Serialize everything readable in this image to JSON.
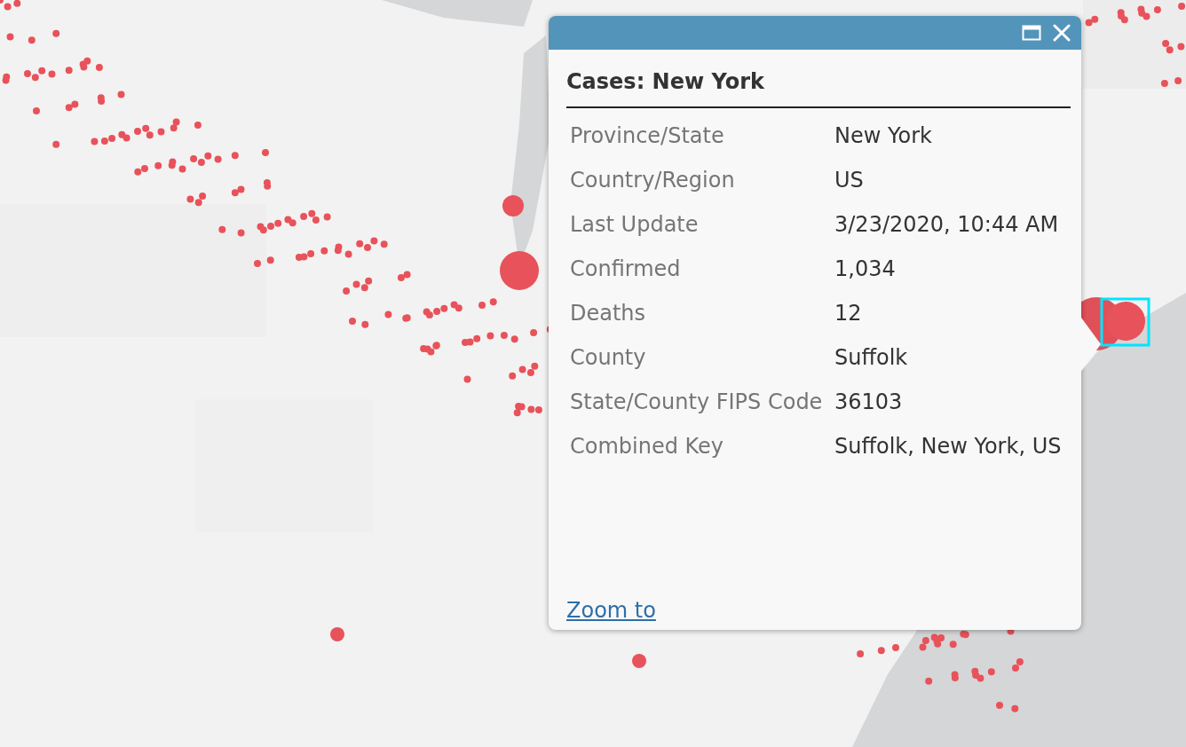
{
  "popup": {
    "title": "Cases: New York",
    "fields": [
      {
        "label": "Province/State",
        "value": "New York"
      },
      {
        "label": "Country/Region",
        "value": "US"
      },
      {
        "label": "Last Update",
        "value": "3/23/2020, 10:44 AM"
      },
      {
        "label": "Confirmed",
        "value": "1,034"
      },
      {
        "label": "Deaths",
        "value": "12"
      },
      {
        "label": "County",
        "value": "Suffolk"
      },
      {
        "label": "State/County FIPS Code",
        "value": "36103"
      },
      {
        "label": "Combined Key",
        "value": "Suffolk, New York, US"
      }
    ],
    "link": "Zoom to"
  }
}
